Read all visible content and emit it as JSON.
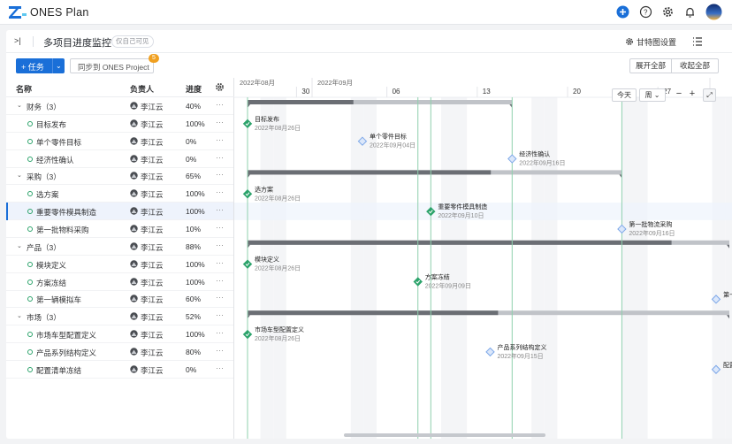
{
  "topbar": {
    "app_name": "ONES Plan"
  },
  "header": {
    "title": "多项目进度监控",
    "visibility": "仅自己可见",
    "gantt_settings": "甘特图设置"
  },
  "toolbar": {
    "task_label": "+ 任务",
    "sync_label": "同步到 ONES Project",
    "sync_badge": "5",
    "expand_all": "展开全部",
    "collapse_all": "收起全部"
  },
  "columns": {
    "name": "名称",
    "owner": "负责人",
    "progress": "进度"
  },
  "rows": [
    {
      "name": "财务（3）",
      "owner": "李江云",
      "progress": "40%",
      "group": true
    },
    {
      "name": "目标发布",
      "owner": "李江云",
      "progress": "100%",
      "group": false
    },
    {
      "name": "单个零件目标",
      "owner": "李江云",
      "progress": "0%",
      "group": false
    },
    {
      "name": "经济性确认",
      "owner": "李江云",
      "progress": "0%",
      "group": false
    },
    {
      "name": "采购（3）",
      "owner": "李江云",
      "progress": "65%",
      "group": true
    },
    {
      "name": "选方案",
      "owner": "李江云",
      "progress": "100%",
      "group": false
    },
    {
      "name": "重要零件模具制造",
      "owner": "李江云",
      "progress": "100%",
      "group": false
    },
    {
      "name": "第一批物料采购",
      "owner": "李江云",
      "progress": "10%",
      "group": false
    },
    {
      "name": "产品（3）",
      "owner": "李江云",
      "progress": "88%",
      "group": true
    },
    {
      "name": "模块定义",
      "owner": "李江云",
      "progress": "100%",
      "group": false
    },
    {
      "name": "方案冻结",
      "owner": "李江云",
      "progress": "100%",
      "group": false
    },
    {
      "name": "第一辆模拟车",
      "owner": "李江云",
      "progress": "60%",
      "group": false
    },
    {
      "name": "市场（3）",
      "owner": "李江云",
      "progress": "52%",
      "group": true
    },
    {
      "name": "市场车型配置定义",
      "owner": "李江云",
      "progress": "100%",
      "group": false
    },
    {
      "name": "产品系列结构定义",
      "owner": "李江云",
      "progress": "80%",
      "group": false
    },
    {
      "name": "配置清单冻结",
      "owner": "李江云",
      "progress": "0%",
      "group": false
    }
  ],
  "gantt": {
    "months": [
      "2022年08月",
      "2022年09月"
    ],
    "days": [
      "30",
      "06",
      "13",
      "20",
      "27"
    ],
    "controls": {
      "today": "今天",
      "scale": "周"
    },
    "milestones": [
      {
        "name": "目标发布",
        "date": "2022年08月26日",
        "done": true
      },
      {
        "name": "单个零件目标",
        "date": "2022年09月04日",
        "done": false
      },
      {
        "name": "经济性确认",
        "date": "2022年09月16日",
        "done": false
      },
      {
        "name": "选方案",
        "date": "2022年08月26日",
        "done": true
      },
      {
        "name": "重要零件模具制造",
        "date": "2022年09月10日",
        "done": true
      },
      {
        "name": "第一批物流采购",
        "date": "2022年09月16日",
        "done": false
      },
      {
        "name": "模块定义",
        "date": "2022年08月26日",
        "done": true
      },
      {
        "name": "方案冻结",
        "date": "2022年09月09日",
        "done": true
      },
      {
        "name": "第一",
        "date": "",
        "done": false
      },
      {
        "name": "市场车型配置定义",
        "date": "2022年08月26日",
        "done": true
      },
      {
        "name": "产品系列结构定义",
        "date": "2022年09月15日",
        "done": false
      },
      {
        "name": "配置",
        "date": "",
        "done": false
      }
    ]
  },
  "colors": {
    "primary": "#1a6fd8",
    "done": "#2ca36b",
    "pending": "#7ca7e8",
    "bar": "#6b6e74"
  }
}
